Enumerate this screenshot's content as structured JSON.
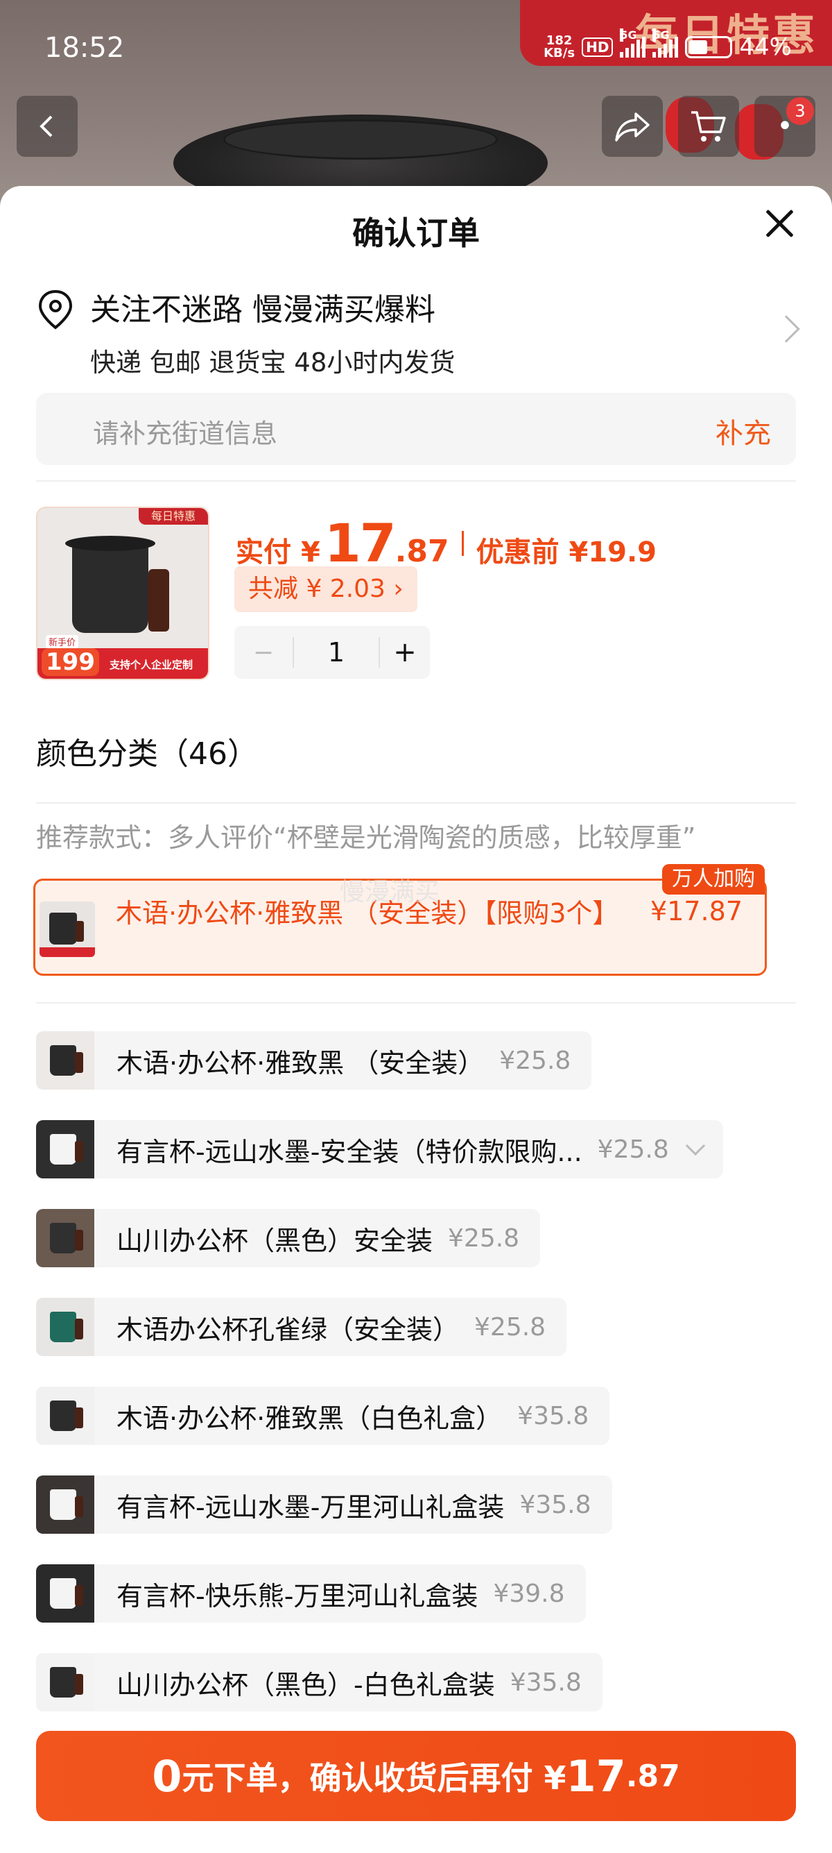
{
  "status_bar": {
    "time": "18:52",
    "net_speed_top": "182",
    "net_speed_bottom": "KB/s",
    "hd": "HD",
    "sig1": "5G",
    "sig2": "5G",
    "battery": "44%"
  },
  "background": {
    "banner_text": "每日特惠",
    "cart_count": "3"
  },
  "sheet": {
    "title": "确认订单"
  },
  "address": {
    "name": "关注不迷路 慢漫满买爆料",
    "subtitle": "快递 包邮 退货宝 48小时内发货",
    "street_placeholder": "请补充街道信息",
    "street_button": "补充"
  },
  "product": {
    "image_tag": "每日特惠",
    "image_price": "199",
    "image_small": "新手价",
    "image_slogan": "支持个人企业定制",
    "pay_label": "实付",
    "yen": "¥",
    "price_int": "17",
    "price_dec": ".87",
    "before_label": "优惠前 ¥19.9",
    "discount": "共减 ¥ 2.03 ›",
    "quantity": "1",
    "minus": "−",
    "plus": "+"
  },
  "options": {
    "section_title": "颜色分类（46）",
    "recommend": "推荐款式：多人评价“杯壁是光滑陶瓷的质感，比较厚重”",
    "watermark": "慢漫满买",
    "selected": {
      "name": "木语·办公杯·雅致黑 （安全装）【限购3个】",
      "price": "¥17.87",
      "tag": "万人加购"
    },
    "items": [
      {
        "name": "木语·办公杯·雅致黑 （安全装）",
        "price": "¥25.8",
        "cup": "#2b2a2a",
        "bg": "#ece9e7"
      },
      {
        "name": "有言杯-远山水墨-安全装（特价款限购...",
        "price": "¥25.8",
        "cup": "#f4f4f4",
        "bg": "#2e2e2e"
      },
      {
        "name": "山川办公杯（黑色）安全装",
        "price": "¥25.8",
        "cup": "#303030",
        "bg": "#6a5a50"
      },
      {
        "name": "木语办公杯孔雀绿（安全装）",
        "price": "¥25.8",
        "cup": "#1f6b5c",
        "bg": "#e8e6e4"
      },
      {
        "name": "木语·办公杯·雅致黑（白色礼盒）",
        "price": "¥35.8",
        "cup": "#2d2c2c",
        "bg": "#f1f1f1"
      },
      {
        "name": "有言杯-远山水墨-万里河山礼盒装",
        "price": "¥35.8",
        "cup": "#f4f4f4",
        "bg": "#3a3532"
      },
      {
        "name": "有言杯-快乐熊-万里河山礼盒装",
        "price": "¥39.8",
        "cup": "#f4f4f4",
        "bg": "#2a2a2a"
      },
      {
        "name": "山川办公杯（黑色）-白色礼盒装",
        "price": "¥35.8",
        "cup": "#2d2c2c",
        "bg": "#f3f3f3"
      }
    ]
  },
  "cta": {
    "part1": "0",
    "part2": "元下单，确认收货后再付 ¥",
    "part3": "17",
    "part4": ".87"
  },
  "colors": {
    "accent": "#ef4a14",
    "accent_light": "#fde6dc",
    "muted": "#9a9a9a"
  }
}
